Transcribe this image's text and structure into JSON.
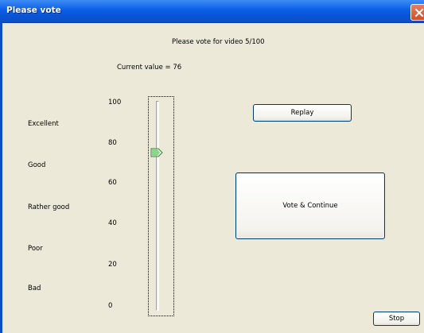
{
  "window": {
    "title": "Please vote"
  },
  "header": {
    "prompt": "Please vote for video 5/100",
    "current_value_text": "Current value = 76"
  },
  "scale": {
    "labels": [
      "Excellent",
      "Good",
      "Rather good",
      "Poor",
      "Bad"
    ],
    "ticks": [
      "100",
      "80",
      "60",
      "40",
      "20",
      "0"
    ]
  },
  "slider": {
    "value": 76,
    "min": 0,
    "max": 100
  },
  "buttons": {
    "replay": "Replay",
    "vote_continue": "Vote & Continue",
    "stop": "Stop"
  },
  "colors": {
    "titlebar": "#0b5ee8",
    "thumb": "#3fae49",
    "background": "#ece9d8"
  }
}
